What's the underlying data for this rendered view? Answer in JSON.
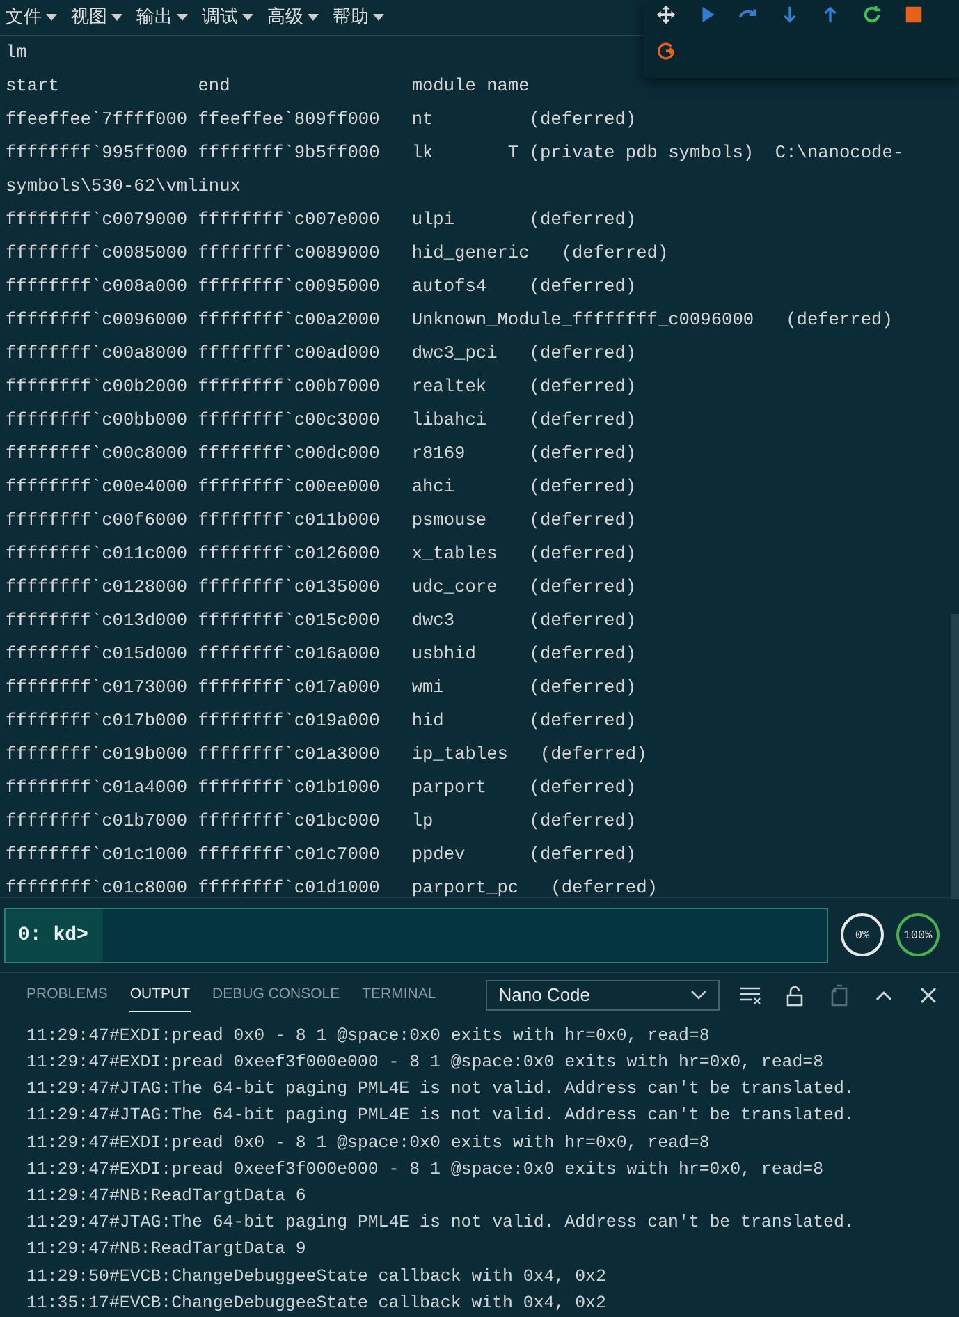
{
  "menu": [
    {
      "label": "文件"
    },
    {
      "label": "视图"
    },
    {
      "label": "输出"
    },
    {
      "label": "调试"
    },
    {
      "label": "高级"
    },
    {
      "label": "帮助"
    }
  ],
  "debug_toolbar": {
    "buttons": [
      {
        "kind": "move"
      },
      {
        "kind": "continue"
      },
      {
        "kind": "step-over"
      },
      {
        "kind": "step-into"
      },
      {
        "kind": "step-out"
      },
      {
        "kind": "restart"
      },
      {
        "kind": "stop"
      },
      {
        "kind": "disconnect"
      }
    ]
  },
  "console": {
    "lines": [
      "lm",
      "start             end                 module name",
      "ffeeffee`7ffff000 ffeeffee`809ff000   nt         (deferred)",
      "ffffffff`995ff000 ffffffff`9b5ff000   lk       T (private pdb symbols)  C:\\nanocode-symbols\\530-62\\vmlinux",
      "ffffffff`c0079000 ffffffff`c007e000   ulpi       (deferred)",
      "ffffffff`c0085000 ffffffff`c0089000   hid_generic   (deferred)",
      "ffffffff`c008a000 ffffffff`c0095000   autofs4    (deferred)",
      "ffffffff`c0096000 ffffffff`c00a2000   Unknown_Module_ffffffff_c0096000   (deferred)",
      "ffffffff`c00a8000 ffffffff`c00ad000   dwc3_pci   (deferred)",
      "ffffffff`c00b2000 ffffffff`c00b7000   realtek    (deferred)",
      "ffffffff`c00bb000 ffffffff`c00c3000   libahci    (deferred)",
      "ffffffff`c00c8000 ffffffff`c00dc000   r8169      (deferred)",
      "ffffffff`c00e4000 ffffffff`c00ee000   ahci       (deferred)",
      "ffffffff`c00f6000 ffffffff`c011b000   psmouse    (deferred)",
      "ffffffff`c011c000 ffffffff`c0126000   x_tables   (deferred)",
      "ffffffff`c0128000 ffffffff`c0135000   udc_core   (deferred)",
      "ffffffff`c013d000 ffffffff`c015c000   dwc3       (deferred)",
      "ffffffff`c015d000 ffffffff`c016a000   usbhid     (deferred)",
      "ffffffff`c0173000 ffffffff`c017a000   wmi        (deferred)",
      "ffffffff`c017b000 ffffffff`c019a000   hid        (deferred)",
      "ffffffff`c019b000 ffffffff`c01a3000   ip_tables   (deferred)",
      "ffffffff`c01a4000 ffffffff`c01b1000   parport    (deferred)",
      "ffffffff`c01b7000 ffffffff`c01bc000   lp         (deferred)",
      "ffffffff`c01c1000 ffffffff`c01c7000   ppdev      (deferred)",
      "ffffffff`c01c8000 ffffffff`c01d1000   parport_pc   (deferred)"
    ]
  },
  "command": {
    "prompt": "0: kd>"
  },
  "gauges": [
    {
      "label": "0%",
      "color": "#e8e8e8"
    },
    {
      "label": "100%",
      "color": "#4caf50"
    }
  ],
  "panel": {
    "tabs": [
      {
        "label": "PROBLEMS",
        "selected": false
      },
      {
        "label": "OUTPUT",
        "selected": true
      },
      {
        "label": "DEBUG CONSOLE",
        "selected": false
      },
      {
        "label": "TERMINAL",
        "selected": false
      }
    ],
    "channel": "Nano Code",
    "actions": [
      {
        "kind": "clear",
        "disabled": false
      },
      {
        "kind": "lock",
        "disabled": false
      },
      {
        "kind": "copy",
        "disabled": true
      },
      {
        "kind": "maximize",
        "disabled": false
      },
      {
        "kind": "close",
        "disabled": false
      }
    ],
    "output": [
      "11:29:47#EXDI:pread 0x0 - 8 1 @space:0x0 exits with hr=0x0, read=8",
      "11:29:47#EXDI:pread 0xeef3f000e000 - 8 1 @space:0x0 exits with hr=0x0, read=8",
      "11:29:47#JTAG:The 64-bit paging PML4E is not valid. Address can't be translated.",
      "11:29:47#JTAG:The 64-bit paging PML4E is not valid. Address can't be translated.",
      "11:29:47#EXDI:pread 0x0 - 8 1 @space:0x0 exits with hr=0x0, read=8",
      "11:29:47#EXDI:pread 0xeef3f000e000 - 8 1 @space:0x0 exits with hr=0x0, read=8",
      "11:29:47#NB:ReadTargtData 6",
      "11:29:47#JTAG:The 64-bit paging PML4E is not valid. Address can't be translated.",
      "11:29:47#NB:ReadTargtData 9",
      "11:29:50#EVCB:ChangeDebuggeeState callback with 0x4, 0x2",
      "11:35:17#EVCB:ChangeDebuggeeState callback with 0x4, 0x2"
    ]
  }
}
